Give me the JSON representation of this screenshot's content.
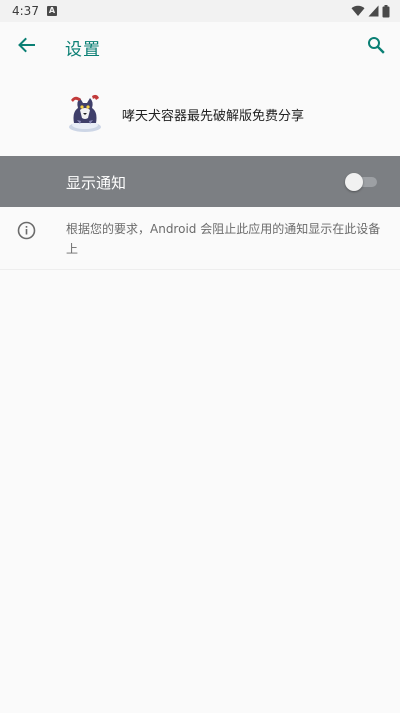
{
  "status_bar": {
    "time": "4:37",
    "notification_icon": "A",
    "icons": [
      "wifi-icon",
      "signal-icon",
      "battery-icon"
    ]
  },
  "toolbar": {
    "title": "设置",
    "back_icon": "arrow-left-icon",
    "search_icon": "search-icon",
    "accent_color": "#0a7f74"
  },
  "app": {
    "name": "哮天犬容器最先破解版免费分享",
    "icon": "app-icon-dog"
  },
  "settings": {
    "show_notifications_label": "显示通知",
    "show_notifications_enabled": false
  },
  "info": {
    "icon": "info-icon",
    "text": "根据您的要求，Android 会阻止此应用的通知显示在此设备上"
  }
}
